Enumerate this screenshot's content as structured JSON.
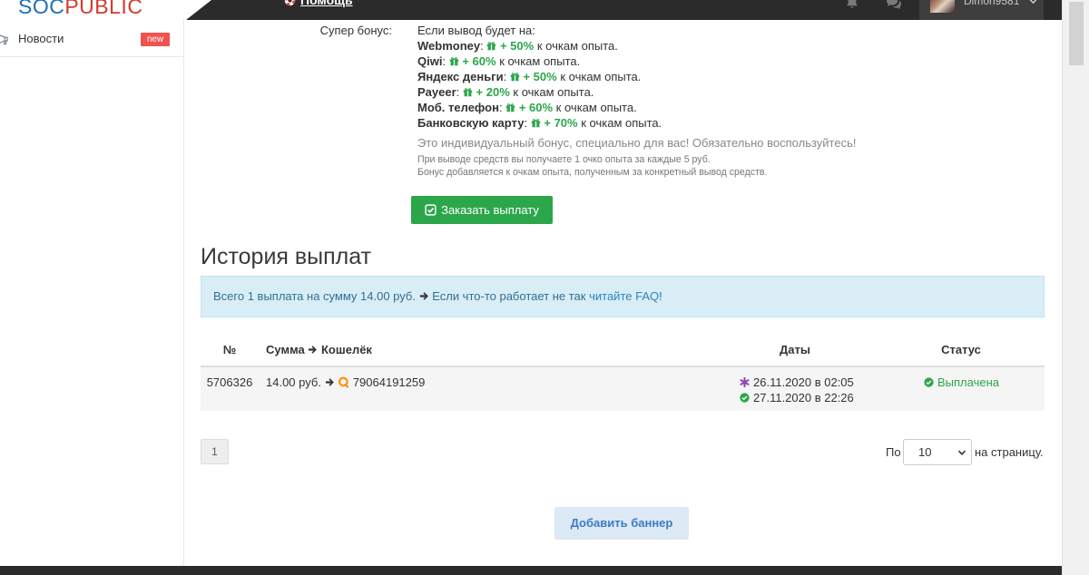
{
  "header": {
    "logo_part1": "SOC",
    "logo_part2": "PUBLIC",
    "help_label": "Помощь",
    "username": "Dimon9581",
    "icons": {
      "help": "lifebuoy-icon",
      "notifications": "bell-icon",
      "messages": "comments-icon",
      "user_menu": "chevron-down-icon"
    }
  },
  "sidebar": {
    "items": [
      {
        "label": "Новости",
        "badge": "new",
        "icon": "bullhorn-icon"
      }
    ]
  },
  "bonus": {
    "label": "Супер бонус:",
    "intro": "Если вывод будет на:",
    "separator": ":",
    "suffix": "к очкам опыта.",
    "icon": "gift-icon",
    "items": [
      {
        "method": "Webmoney",
        "percent": "+ 50%"
      },
      {
        "method": "Qiwi",
        "percent": "+ 60%"
      },
      {
        "method": "Яндекс деньги",
        "percent": "+ 50%"
      },
      {
        "method": "Payeer",
        "percent": "+ 20%"
      },
      {
        "method": "Моб. телефон",
        "percent": "+ 60%"
      },
      {
        "method": "Банковскую карту",
        "percent": "+ 70%"
      }
    ],
    "note": "Это индивидуальный бонус, специально для вас! Обязательно воспользуйтесь!",
    "fine_print": [
      "При выводе средств вы получаете 1 очко опыта за каждые 5 руб.",
      "Бонус добавляется к очкам опыта, полученным за конкретный вывод средств."
    ]
  },
  "order_button": {
    "label": "Заказать выплату",
    "icon": "check-square-icon"
  },
  "history": {
    "title": "История выплат",
    "alert": {
      "summary": "Всего 1 выплата на сумму 14.00 руб.",
      "hint": "Если что-то работает не так",
      "link": "читайте FAQ",
      "end": "!"
    },
    "table": {
      "headers": {
        "number": "№",
        "amount": "Сумма",
        "wallet": "Кошелёк",
        "dates": "Даты",
        "status": "Статус"
      },
      "rows": [
        {
          "number": "5706326",
          "amount": "14.00 руб.",
          "wallet_icon": "qiwi-icon",
          "wallet": "79064191259",
          "created": "26.11.2020 в 02:05",
          "paid": "27.11.2020 в 22:26",
          "status": "Выплачена"
        }
      ]
    }
  },
  "pagination": {
    "pages": [
      "1"
    ],
    "per_page_prefix": "По",
    "per_page_value": "10",
    "per_page_suffix": "на страницу."
  },
  "add_banner_button": "Добавить баннер",
  "colors": {
    "topbar": "#2b2b2b",
    "logo_blue": "#1d6fb8",
    "logo_red": "#d33a2c",
    "success": "#2ca64a",
    "info_bg": "#d9edf7",
    "info_border": "#bce8f1",
    "info_text": "#31708f",
    "link": "#2f82c0",
    "badge": "#ef5350",
    "pending": "#8e44ad",
    "banner_button_bg": "#dde9f5",
    "banner_button_text": "#3a7cc2"
  }
}
